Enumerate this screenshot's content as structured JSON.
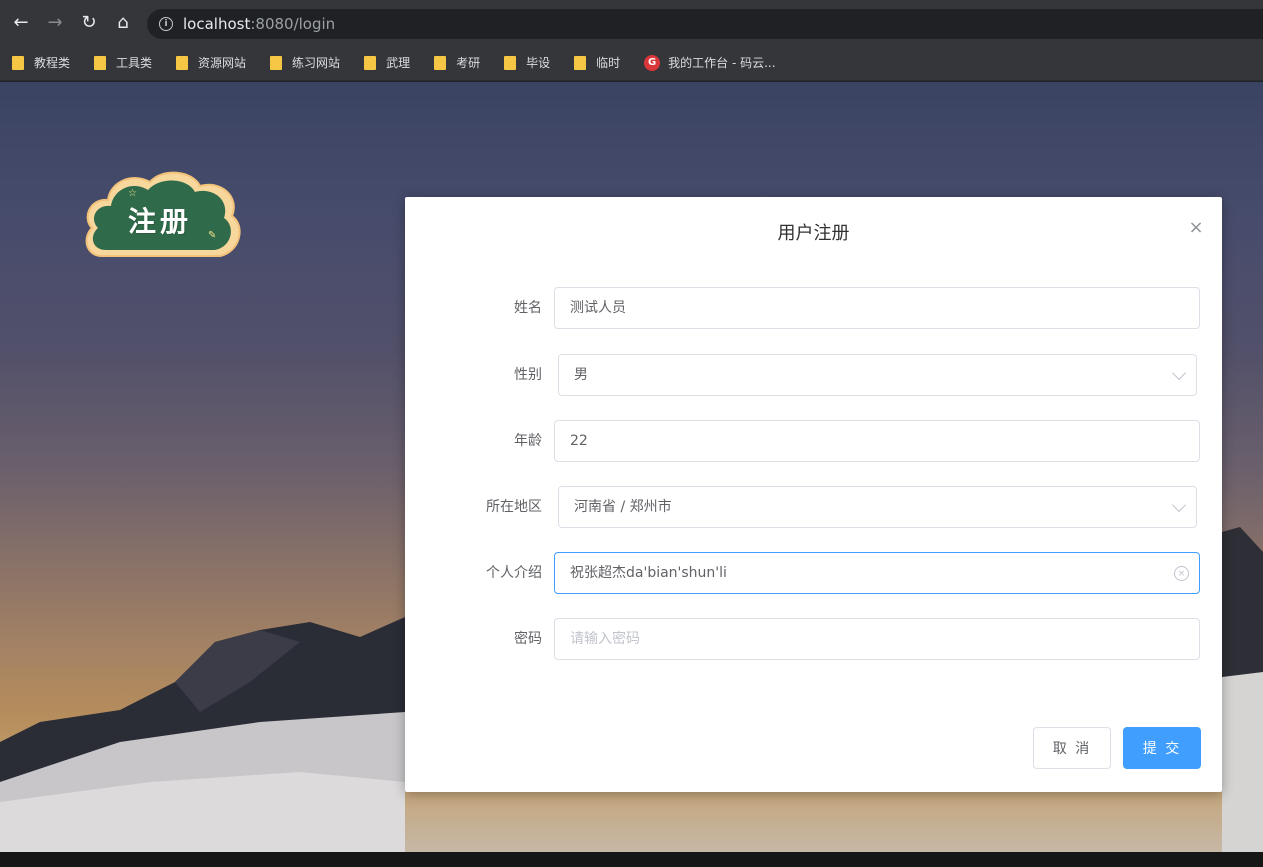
{
  "browser": {
    "url_host": "localhost",
    "url_rest": ":8080/login",
    "bookmarks": [
      {
        "label": "教程类",
        "icon": "folder-icon"
      },
      {
        "label": "工具类",
        "icon": "folder-icon"
      },
      {
        "label": "资源网站",
        "icon": "folder-icon"
      },
      {
        "label": "练习网站",
        "icon": "folder-icon"
      },
      {
        "label": "武理",
        "icon": "folder-icon"
      },
      {
        "label": "考研",
        "icon": "folder-icon"
      },
      {
        "label": "毕设",
        "icon": "folder-icon"
      },
      {
        "label": "临时",
        "icon": "folder-icon"
      },
      {
        "label": "我的工作台 - 码云...",
        "icon": "gitee-icon"
      }
    ]
  },
  "logo": {
    "text": "注册"
  },
  "dialog": {
    "title": "用户注册",
    "close_symbol": "×",
    "fields": {
      "name": {
        "label": "姓名",
        "value": "测试人员"
      },
      "gender": {
        "label": "性别",
        "value": "男"
      },
      "age": {
        "label": "年龄",
        "value": "22"
      },
      "region": {
        "label": "所在地区",
        "value": "河南省 / 郑州市"
      },
      "intro": {
        "label": "个人介绍",
        "value": "祝张超杰da'bian'shun'li"
      },
      "password": {
        "label": "密码",
        "placeholder": "请输入密码"
      }
    },
    "cancel_label": "取 消",
    "submit_label": "提 交"
  },
  "colors": {
    "primary": "#409eff",
    "border": "#dcdfe6",
    "label": "#606266",
    "placeholder": "#c0c4cc"
  }
}
